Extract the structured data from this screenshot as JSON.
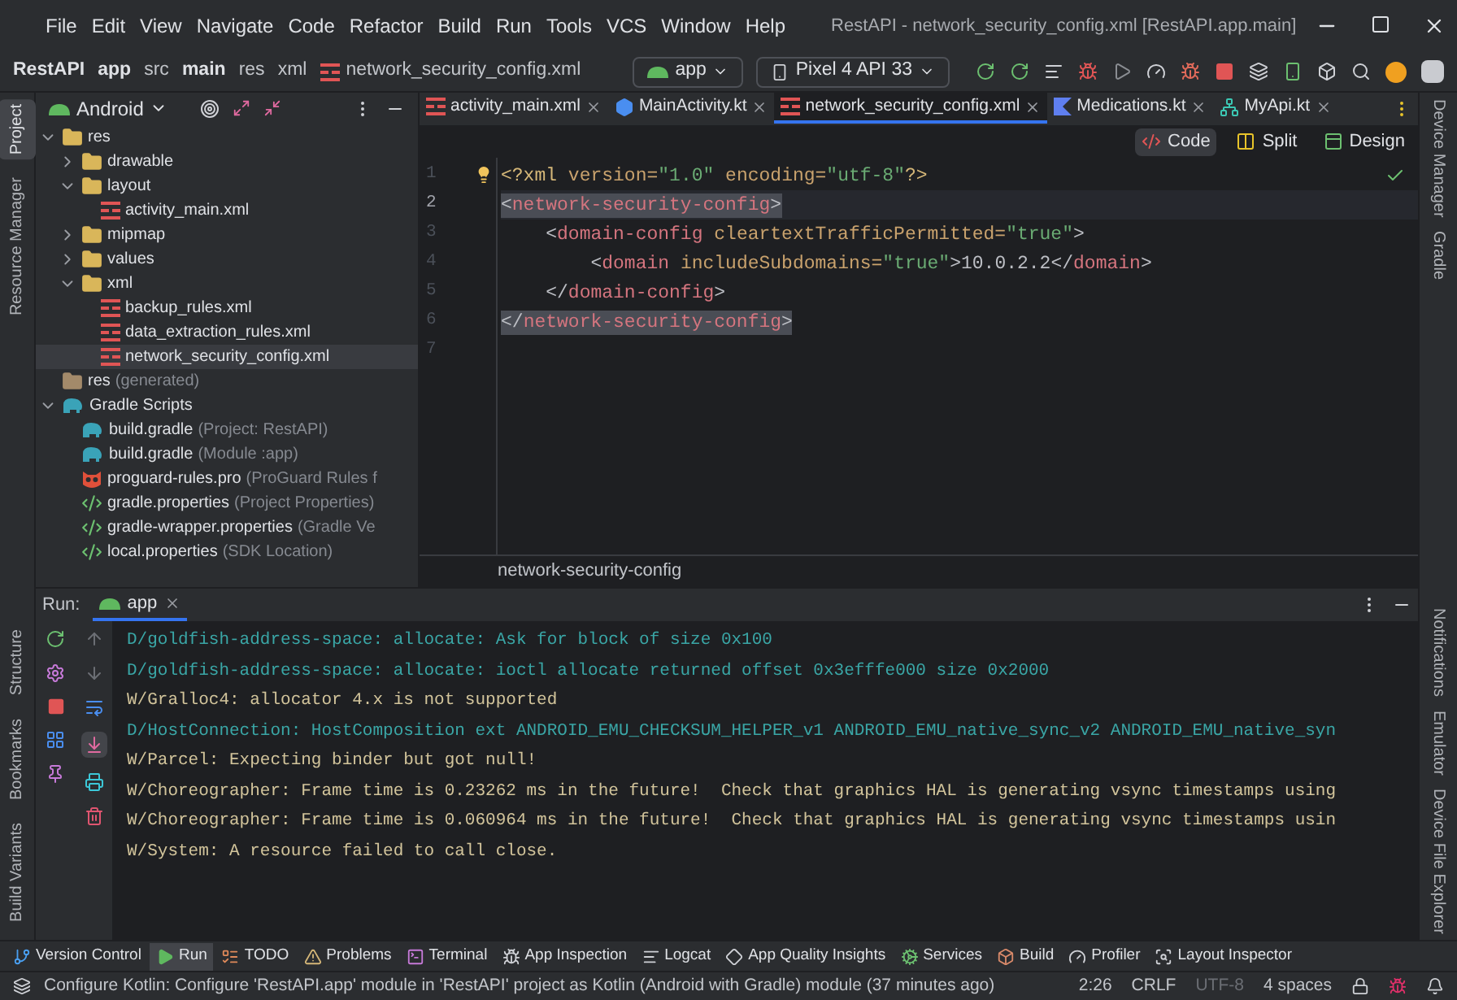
{
  "window": {
    "title": "RestAPI - network_security_config.xml [RestAPI.app.main]"
  },
  "menu": [
    "File",
    "Edit",
    "View",
    "Navigate",
    "Code",
    "Refactor",
    "Build",
    "Run",
    "Tools",
    "VCS",
    "Window",
    "Help"
  ],
  "breadcrumbs": [
    {
      "label": "RestAPI",
      "bold": true,
      "kind": "text"
    },
    {
      "label": "app",
      "bold": true,
      "kind": "text"
    },
    {
      "label": "src",
      "bold": false,
      "kind": "text"
    },
    {
      "label": "main",
      "bold": true,
      "kind": "text"
    },
    {
      "label": "res",
      "bold": false,
      "kind": "text"
    },
    {
      "label": "xml",
      "bold": false,
      "kind": "text"
    },
    {
      "label": "network_security_config.xml",
      "bold": false,
      "kind": "xml"
    }
  ],
  "run_config": {
    "label": "app"
  },
  "device": {
    "label": "Pixel 4 API 33"
  },
  "left_strip": {
    "top": [
      {
        "label": "Project",
        "selected": true
      },
      {
        "label": "Resource Manager",
        "selected": false
      }
    ],
    "bottom": [
      {
        "label": "Structure",
        "selected": false
      },
      {
        "label": "Bookmarks",
        "selected": false
      },
      {
        "label": "Build Variants",
        "selected": false
      }
    ]
  },
  "project_panel": {
    "view": "Android",
    "tree": [
      {
        "label": "res",
        "kind": "folder",
        "expanded": true,
        "selected": false,
        "children": [
          {
            "label": "drawable",
            "kind": "folder",
            "expanded": false,
            "selected": false
          },
          {
            "label": "layout",
            "kind": "folder",
            "expanded": true,
            "selected": false,
            "children": [
              {
                "label": "activity_main.xml",
                "kind": "xml",
                "selected": false
              }
            ]
          },
          {
            "label": "mipmap",
            "kind": "folder",
            "expanded": false,
            "selected": false
          },
          {
            "label": "values",
            "kind": "folder",
            "expanded": false,
            "selected": false
          },
          {
            "label": "xml",
            "kind": "folder",
            "expanded": true,
            "selected": false,
            "children": [
              {
                "label": "backup_rules.xml",
                "kind": "xml",
                "selected": false
              },
              {
                "label": "data_extraction_rules.xml",
                "kind": "xml",
                "selected": false
              },
              {
                "label": "network_security_config.xml",
                "kind": "xml",
                "selected": true
              }
            ]
          }
        ]
      },
      {
        "label": "res",
        "note": "(generated)",
        "kind": "res-folder",
        "selected": false
      },
      {
        "label": "Gradle Scripts",
        "kind": "gradle",
        "expanded": true,
        "selected": false,
        "children": [
          {
            "label": "build.gradle",
            "note": "(Project: RestAPI)",
            "kind": "gradle",
            "selected": false
          },
          {
            "label": "build.gradle",
            "note": "(Module :app)",
            "kind": "gradle",
            "selected": false
          },
          {
            "label": "proguard-rules.pro",
            "note": "(ProGuard Rules f",
            "kind": "proguard",
            "selected": false
          },
          {
            "label": "gradle.properties",
            "note": "(Project Properties)",
            "kind": "properties",
            "selected": false
          },
          {
            "label": "gradle-wrapper.properties",
            "note": "(Gradle Ve",
            "kind": "properties",
            "selected": false
          },
          {
            "label": "local.properties",
            "note": "(SDK Location)",
            "kind": "properties",
            "selected": false
          }
        ]
      }
    ]
  },
  "editor": {
    "tabs": [
      {
        "label": "activity_main.xml",
        "kind": "xml",
        "selected": false
      },
      {
        "label": "MainActivity.kt",
        "kind": "class",
        "selected": false
      },
      {
        "label": "network_security_config.xml",
        "kind": "xml",
        "selected": true
      },
      {
        "label": "Medications.kt",
        "kind": "kotlin",
        "selected": false
      },
      {
        "label": "MyApi.kt",
        "kind": "api",
        "selected": false
      }
    ],
    "view_modes": [
      {
        "label": "Code",
        "kind": "code",
        "selected": true
      },
      {
        "label": "Split",
        "kind": "split",
        "selected": false
      },
      {
        "label": "Design",
        "kind": "design",
        "selected": false
      }
    ],
    "lines": [
      {
        "number": "1",
        "current": false,
        "highlighted": false,
        "tokens": [
          {
            "text": "<?xml ",
            "kind": "meta"
          },
          {
            "text": "version=",
            "kind": "attr"
          },
          {
            "text": "\"1.0\"",
            "kind": "string"
          },
          {
            "text": " encoding=",
            "kind": "attr"
          },
          {
            "text": "\"utf-8\"",
            "kind": "string"
          },
          {
            "text": "?>",
            "kind": "meta"
          }
        ]
      },
      {
        "number": "2",
        "current": true,
        "highlighted": true,
        "tokens": [
          {
            "text": "<",
            "kind": "bracket"
          },
          {
            "text": "network-security-config",
            "kind": "tag"
          },
          {
            "text": ">",
            "kind": "bracket"
          }
        ]
      },
      {
        "number": "3",
        "current": false,
        "highlighted": false,
        "tokens": [
          {
            "text": "    <",
            "kind": "bracket"
          },
          {
            "text": "domain-config",
            "kind": "tag"
          },
          {
            "text": " cleartextTrafficPermitted=",
            "kind": "attr"
          },
          {
            "text": "\"true\"",
            "kind": "string"
          },
          {
            "text": ">",
            "kind": "bracket"
          }
        ]
      },
      {
        "number": "4",
        "current": false,
        "highlighted": false,
        "tokens": [
          {
            "text": "        <",
            "kind": "bracket"
          },
          {
            "text": "domain",
            "kind": "tag"
          },
          {
            "text": " includeSubdomains=",
            "kind": "attr"
          },
          {
            "text": "\"true\"",
            "kind": "string"
          },
          {
            "text": ">10.0.2.2</",
            "kind": "bracket"
          },
          {
            "text": "domain",
            "kind": "tag"
          },
          {
            "text": ">",
            "kind": "bracket"
          }
        ]
      },
      {
        "number": "5",
        "current": false,
        "highlighted": false,
        "tokens": [
          {
            "text": "    </",
            "kind": "bracket"
          },
          {
            "text": "domain-config",
            "kind": "tag"
          },
          {
            "text": ">",
            "kind": "bracket"
          }
        ]
      },
      {
        "number": "6",
        "current": false,
        "highlighted": true,
        "tokens": [
          {
            "text": "</",
            "kind": "bracket"
          },
          {
            "text": "network-security-config",
            "kind": "tag"
          },
          {
            "text": ">",
            "kind": "bracket"
          }
        ]
      },
      {
        "number": "7",
        "current": false
      }
    ],
    "breadcrumb": "network-security-config"
  },
  "right_strip": {
    "top": [
      "Device Manager",
      "Gradle"
    ],
    "bottom": [
      "Notifications",
      "Emulator",
      "Device File Explorer"
    ]
  },
  "run_panel": {
    "label": "Run:",
    "tabs": [
      {
        "label": "app",
        "selected": true
      }
    ],
    "log": [
      {
        "kind": "debug",
        "text": "D/goldfish-address-space: allocate: Ask for block of size 0x100"
      },
      {
        "kind": "debug",
        "text": "D/goldfish-address-space: allocate: ioctl allocate returned offset 0x3efffe000 size 0x2000"
      },
      {
        "kind": "warning",
        "text": "W/Gralloc4: allocator 4.x is not supported"
      },
      {
        "kind": "debug",
        "text": "D/HostConnection: HostComposition ext ANDROID_EMU_CHECKSUM_HELPER_v1 ANDROID_EMU_native_sync_v2 ANDROID_EMU_native_syn"
      },
      {
        "kind": "warning",
        "text": "W/Parcel: Expecting binder but got null!"
      },
      {
        "kind": "warning",
        "text": "W/Choreographer: Frame time is 0.23262 ms in the future!  Check that graphics HAL is generating vsync timestamps using"
      },
      {
        "kind": "warning",
        "text": "W/Choreographer: Frame time is 0.060964 ms in the future!  Check that graphics HAL is generating vsync timestamps usin"
      },
      {
        "kind": "warning",
        "text": "W/System: A resource failed to call close."
      }
    ]
  },
  "tool_tabs": [
    {
      "label": "Version Control",
      "kind": "vcs",
      "selected": false
    },
    {
      "label": "Run",
      "kind": "run",
      "selected": true
    },
    {
      "label": "TODO",
      "kind": "todo",
      "selected": false
    },
    {
      "label": "Problems",
      "kind": "problems",
      "selected": false
    },
    {
      "label": "Terminal",
      "kind": "terminal",
      "selected": false
    },
    {
      "label": "App Inspection",
      "kind": "inspection",
      "selected": false
    },
    {
      "label": "Logcat",
      "kind": "logcat",
      "selected": false
    },
    {
      "label": "App Quality Insights",
      "kind": "insights",
      "selected": false
    },
    {
      "label": "Services",
      "kind": "services",
      "selected": false
    },
    {
      "label": "Build",
      "kind": "build",
      "selected": false
    },
    {
      "label": "Profiler",
      "kind": "profiler",
      "selected": false
    },
    {
      "label": "Layout Inspector",
      "kind": "layout",
      "selected": false
    }
  ],
  "status_bar": {
    "message": "Configure Kotlin: Configure 'RestAPI.app' module in 'RestAPI' project as Kotlin (Android with Gradle) module (37 minutes ago)",
    "items": [
      {
        "label": "2:26",
        "disabled": false
      },
      {
        "label": "CRLF",
        "disabled": false
      },
      {
        "label": "UTF-8",
        "disabled": true
      },
      {
        "label": "4 spaces",
        "disabled": false
      }
    ]
  }
}
